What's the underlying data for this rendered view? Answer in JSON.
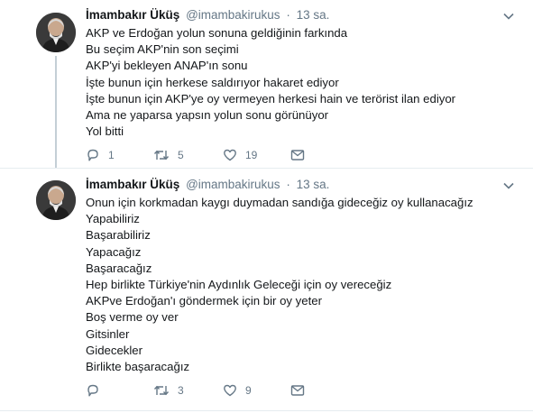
{
  "tweets": [
    {
      "name": "İmambakır Üküş",
      "handle": "@imambakirukus",
      "separator": "·",
      "time": "13 sa.",
      "lines": [
        "AKP ve Erdoğan yolun sonuna geldiğinin farkında",
        "Bu seçim AKP'nin son seçimi",
        "AKP'yi bekleyen ANAP'ın sonu",
        "İşte bunun için herkese saldırıyor hakaret ediyor",
        "İşte bunun için AKP'ye oy vermeyen herkesi hain ve terörist ilan ediyor",
        "Ama ne yaparsa yapsın yolun sonu görünüyor",
        "Yol bitti"
      ],
      "replies": "1",
      "retweets": "5",
      "likes": "19"
    },
    {
      "name": "İmambakır Üküş",
      "handle": "@imambakirukus",
      "separator": "·",
      "time": "13 sa.",
      "lines": [
        "Onun için korkmadan kaygı duymadan sandığa gideceğiz oy kullanacağız",
        "Yapabiliriz",
        "Başarabiliriz",
        "Yapacağız",
        "Başaracağız",
        "Hep birlikte Türkiye'nin Aydınlık Geleceği için oy vereceğiz",
        "AKPve Erdoğan'ı göndermek için bir oy yeter",
        "Boş verme oy ver",
        "Gitsinler",
        "Gidecekler",
        "Birlikte başaracağız"
      ],
      "replies": "",
      "retweets": "3",
      "likes": "9"
    }
  ],
  "icons": {
    "reply": "reply-icon",
    "retweet": "retweet-icon",
    "like": "heart-icon",
    "dm": "direct-message-icon",
    "caret": "chevron-down-icon"
  },
  "colors": {
    "text": "#14171a",
    "muted": "#657786",
    "thread_line": "#c4cfd6",
    "divider": "#e6ecf0"
  }
}
